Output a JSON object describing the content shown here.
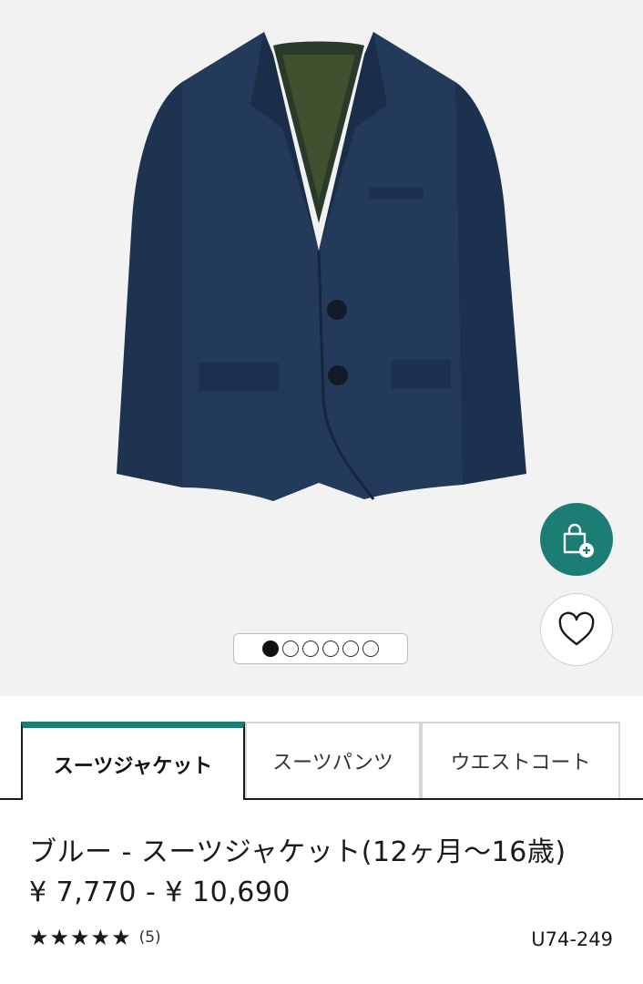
{
  "product": {
    "title": "ブルー - スーツジャケット(12ヶ月〜16歳)",
    "price": "¥ 7,770 - ¥ 10,690",
    "rating_stars": 5,
    "review_count": "(5)",
    "sku": "U74-249"
  },
  "gallery": {
    "image_count": 6,
    "active_index": 0
  },
  "tabs": [
    {
      "label": "スーツジャケット",
      "active": true
    },
    {
      "label": "スーツパンツ",
      "active": false
    },
    {
      "label": "ウエストコート",
      "active": false
    }
  ],
  "actions": {
    "cart_icon": "shopping-bag-add-icon",
    "favorite_icon": "heart-icon"
  },
  "colors": {
    "accent": "#1c7d74",
    "jacket": "#1f3553",
    "background": "#f2f2f2"
  }
}
